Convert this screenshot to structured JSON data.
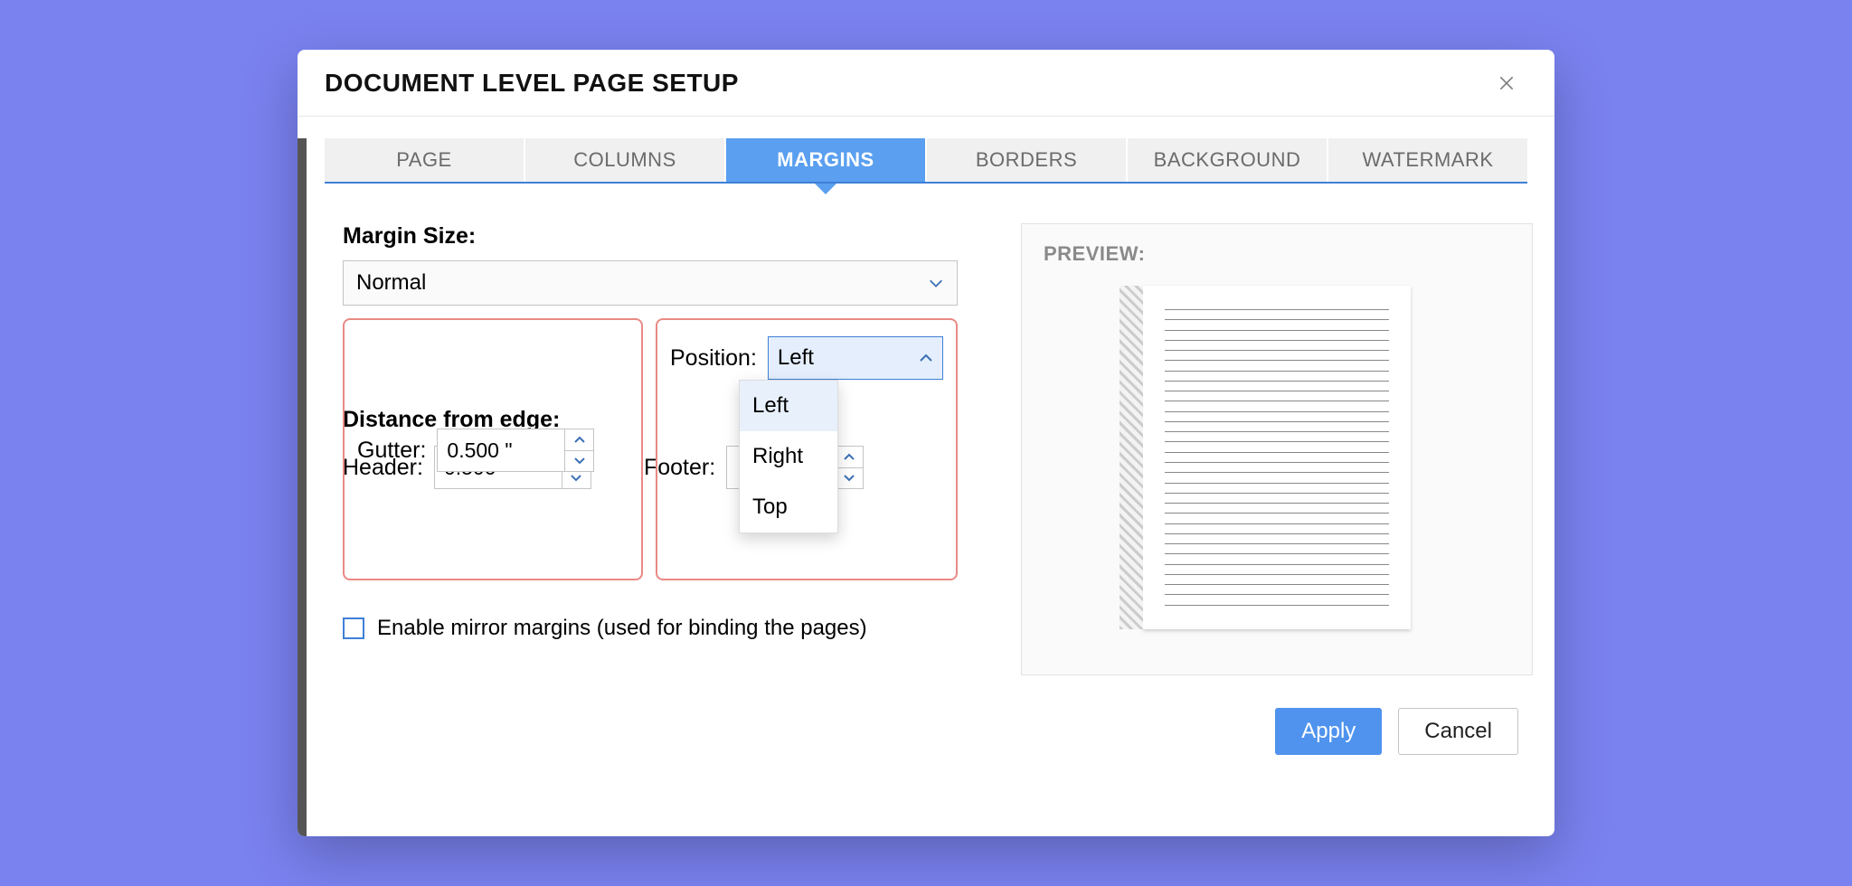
{
  "dialog": {
    "title": "DOCUMENT LEVEL PAGE SETUP"
  },
  "tabs": {
    "page": "PAGE",
    "columns": "COLUMNS",
    "margins": "MARGINS",
    "borders": "BORDERS",
    "background": "BACKGROUND",
    "watermark": "WATERMARK",
    "active": "margins"
  },
  "margins": {
    "section_label": "Margin Size:",
    "size_value": "Normal",
    "gutter_label": "Gutter:",
    "gutter_value": "0.500 \"",
    "position_label": "Position:",
    "position_value": "Left",
    "position_options": {
      "left": "Left",
      "right": "Right",
      "top": "Top"
    }
  },
  "distance": {
    "section_label": "Distance from edge:",
    "header_label": "Header:",
    "header_value": "0.500",
    "footer_label": "Footer:",
    "footer_value": ""
  },
  "mirror": {
    "label": "Enable mirror margins (used for binding the pages)",
    "checked": false
  },
  "preview": {
    "title": "PREVIEW:"
  },
  "buttons": {
    "apply": "Apply",
    "cancel": "Cancel"
  }
}
